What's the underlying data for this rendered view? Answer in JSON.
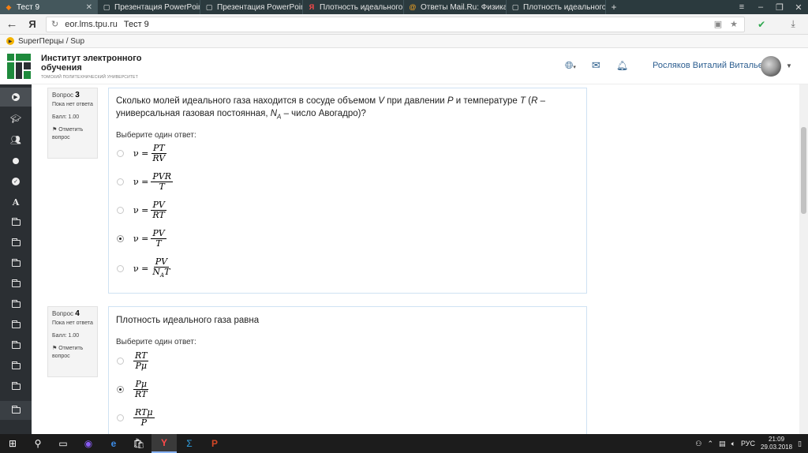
{
  "browser": {
    "tabs": [
      {
        "title": "Тест 9",
        "active": true,
        "icon": "moodle-icon"
      },
      {
        "title": "Презентация PowerPoint",
        "active": false,
        "icon": "page-icon"
      },
      {
        "title": "Презентация PowerPoint",
        "active": false,
        "icon": "page-icon"
      },
      {
        "title": "Плотность идеального газа",
        "active": false,
        "icon": "yandex-icon"
      },
      {
        "title": "Ответы Mail.Ru: Физика. Мо",
        "active": false,
        "icon": "mailru-icon"
      },
      {
        "title": "Плотность идеального газа",
        "active": false,
        "icon": "page-icon"
      }
    ],
    "address": {
      "brand": "Я",
      "url": "eor.lms.tpu.ru",
      "page_title": "Тест 9"
    },
    "bookmark": "SuperПерцы / Sup"
  },
  "site": {
    "org_name": "Институт электронного обучения",
    "org_sub": "ТОМСКИЙ ПОЛИТЕХНИЧЕСКИЙ УНИВЕРСИТЕТ",
    "user_name": "Росляков Виталий Витальевич"
  },
  "questions": [
    {
      "label": "Вопрос",
      "number": "3",
      "status": "Пока нет ответа",
      "score": "Балл: 1.00",
      "flag": "Отметить вопрос",
      "text": "Сколько молей идеального газа находится в сосуде объемом V при давлении P и температуре T (R – универсальная газовая постоянная, NA – число Авогадро)?",
      "prompt": "Выберите один ответ:",
      "options": [
        {
          "lhs": "ν =",
          "num": "PT",
          "den": "RV",
          "selected": false
        },
        {
          "lhs": "ν =",
          "num": "PVR",
          "den": "T",
          "selected": false
        },
        {
          "lhs": "ν =",
          "num": "PV",
          "den": "RT",
          "selected": false
        },
        {
          "lhs": "ν =",
          "num": "PV",
          "den": "T",
          "selected": true
        },
        {
          "lhs": "ν =",
          "num": "PV",
          "den": "NAT",
          "selected": false
        }
      ]
    },
    {
      "label": "Вопрос",
      "number": "4",
      "status": "Пока нет ответа",
      "score": "Балл: 1.00",
      "flag": "Отметить вопрос",
      "text": "Плотность идеального газа равна",
      "prompt": "Выберите один ответ:",
      "options": [
        {
          "lhs": "",
          "num": "RT",
          "den": "Pμ",
          "selected": false
        },
        {
          "lhs": "",
          "num": "Pμ",
          "den": "RT",
          "selected": true
        },
        {
          "lhs": "",
          "num": "RTμ",
          "den": "P",
          "selected": false
        }
      ]
    }
  ],
  "taskbar": {
    "lang": "РУС",
    "time": "21:09",
    "date": "29.03.2018"
  }
}
